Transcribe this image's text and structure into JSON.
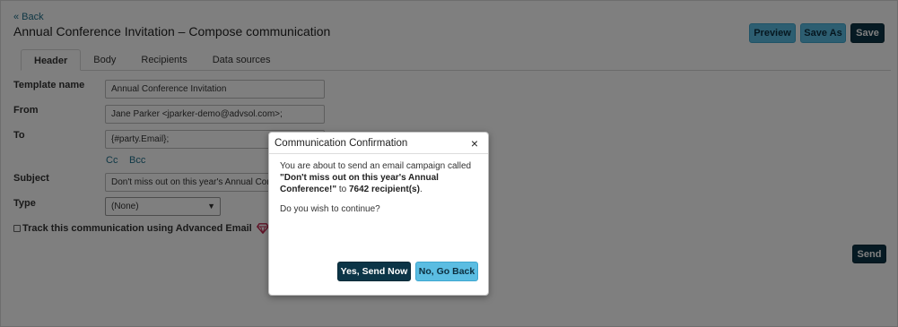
{
  "nav": {
    "back_label": "« Back"
  },
  "page": {
    "title": "Annual Conference Invitation – Compose communication"
  },
  "toolbar": {
    "preview_label": "Preview",
    "save_as_label": "Save As",
    "save_label": "Save"
  },
  "tabs": [
    {
      "label": "Header",
      "active": true
    },
    {
      "label": "Body",
      "active": false
    },
    {
      "label": "Recipients",
      "active": false
    },
    {
      "label": "Data sources",
      "active": false
    }
  ],
  "form": {
    "template_name": {
      "label": "Template name",
      "value": "Annual Conference Invitation"
    },
    "from": {
      "label": "From",
      "value": "Jane Parker <jparker-demo@advsol.com>;"
    },
    "to": {
      "label": "To",
      "value": "{#party.Email};"
    },
    "cc_label": "Cc",
    "bcc_label": "Bcc",
    "subject": {
      "label": "Subject",
      "value": "Don't miss out on this year's Annual Conference!"
    },
    "type": {
      "label": "Type",
      "value": "(None)"
    },
    "track": {
      "label": "Track this communication using Advanced Email",
      "checked": false,
      "icon": "gem-icon"
    },
    "send_label": "Send"
  },
  "modal": {
    "title": "Communication Confirmation",
    "close_glyph": "×",
    "message_pre": "You are about to send an email campaign called ",
    "campaign_name": "\"Don't miss out on this year's Annual Conference!\"",
    "message_mid": " to ",
    "recipient_count": "7642 recipient(s)",
    "message_post": ".",
    "question": "Do you wish to continue?",
    "confirm_label": "Yes, Send Now",
    "cancel_label": "No, Go Back"
  },
  "colors": {
    "primary_dark": "#0c3547",
    "primary_light": "#5bbde2",
    "link": "#1f6f8b",
    "gem": "#c0244d"
  }
}
